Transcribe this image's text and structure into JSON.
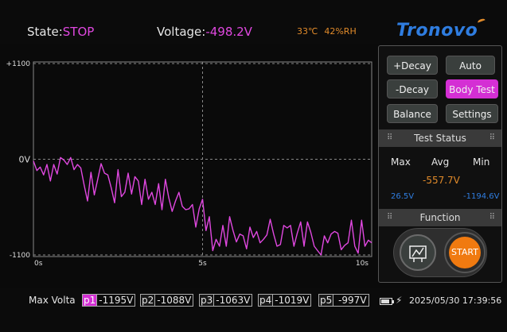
{
  "header": {
    "state_label": "State:",
    "state_value": "STOP",
    "voltage_label": "Voltage:",
    "voltage_value": "-498.2V",
    "temperature": "33℃",
    "humidity": "42%RH",
    "brand": "Tronovo"
  },
  "chart_data": {
    "type": "line",
    "title": "",
    "xlabel": "",
    "ylabel": "",
    "x_ticks": [
      "0s",
      "5s",
      "10s"
    ],
    "y_ticks": [
      "+1100",
      "0V",
      "-1100"
    ],
    "xlim": [
      0,
      10
    ],
    "ylim": [
      -1100,
      1100
    ],
    "grid": "dashed",
    "series": [
      {
        "color": "#e048e0",
        "x": [
          0,
          0.1,
          0.2,
          0.3,
          0.4,
          0.5,
          0.6,
          0.7,
          0.8,
          0.9,
          1.0,
          1.1,
          1.2,
          1.3,
          1.4,
          1.5,
          1.6,
          1.7,
          1.8,
          1.9,
          2.0,
          2.1,
          2.2,
          2.3,
          2.4,
          2.5,
          2.6,
          2.7,
          2.8,
          2.9,
          3.0,
          3.1,
          3.2,
          3.3,
          3.4,
          3.5,
          3.6,
          3.7,
          3.8,
          3.9,
          4.0,
          4.1,
          4.2,
          4.3,
          4.4,
          4.5,
          4.6,
          4.7,
          4.8,
          4.9,
          5.0,
          5.1,
          5.2,
          5.3,
          5.4,
          5.5,
          5.6,
          5.7,
          5.8,
          5.9,
          6.0,
          6.1,
          6.2,
          6.3,
          6.4,
          6.5,
          6.6,
          6.7,
          6.8,
          6.9,
          7.0,
          7.1,
          7.2,
          7.3,
          7.4,
          7.5,
          7.6,
          7.7,
          7.8,
          7.9,
          8.0,
          8.1,
          8.2,
          8.3,
          8.4,
          8.5,
          8.6,
          8.7,
          8.8,
          8.9,
          9.0,
          9.1,
          9.2,
          9.3,
          9.4,
          9.5,
          9.6,
          9.7,
          9.8,
          9.9,
          10.0
        ],
        "y": [
          -20,
          -130,
          -90,
          -180,
          -60,
          -250,
          -60,
          -170,
          20,
          -10,
          -60,
          20,
          -120,
          -60,
          -100,
          -300,
          -480,
          -150,
          -410,
          -230,
          -50,
          -160,
          -180,
          -330,
          -500,
          -120,
          -430,
          -380,
          -160,
          -400,
          -200,
          -250,
          -520,
          -230,
          -460,
          -380,
          -520,
          -280,
          -580,
          -230,
          -440,
          -600,
          -480,
          -380,
          -540,
          -580,
          -570,
          -520,
          -780,
          -570,
          -460,
          -820,
          -660,
          -1050,
          -920,
          -1000,
          -760,
          -1000,
          -660,
          -820,
          -950,
          -860,
          -880,
          -1030,
          -780,
          -900,
          -830,
          -960,
          -920,
          -870,
          -690,
          -860,
          -1000,
          -980,
          -760,
          -790,
          -760,
          -1000,
          -850,
          -720,
          -1000,
          -720,
          -840,
          -1000,
          -1050,
          -1100,
          -880,
          -960,
          -860,
          -830,
          -850,
          -1040,
          -990,
          -960,
          -700,
          -1000,
          -1080,
          -700,
          -1000,
          -930,
          -960
        ]
      }
    ]
  },
  "panel": {
    "buttons": [
      "+Decay",
      "Auto",
      "-Decay",
      "Body Test",
      "Balance",
      "Settings"
    ],
    "active_button": "Body Test",
    "test_status_title": "Test Status",
    "stat_headers": [
      "Max",
      "Avg",
      "Min"
    ],
    "avg_value": "-557.7V",
    "max_value": "26.5V",
    "min_value": "-1194.6V",
    "function_title": "Function",
    "start_label": "START",
    "tool_icon": "resistor-probe-icon"
  },
  "footer": {
    "max_voltage_label": "Max Volta",
    "peaks": [
      {
        "tag": "p1",
        "value": "-1195V"
      },
      {
        "tag": "p2",
        "value": "-1088V"
      },
      {
        "tag": "p3",
        "value": "-1063V"
      },
      {
        "tag": "p4",
        "value": "-1019V"
      },
      {
        "tag": "p5",
        "value": " -997V"
      }
    ],
    "battery_level": 0.85,
    "datetime": "2025/05/30 17:39:56"
  },
  "colors": {
    "accent": "#e048e0",
    "orange": "#e08a2a",
    "brand_blue": "#2f7de0",
    "start_orange": "#f07a10"
  }
}
